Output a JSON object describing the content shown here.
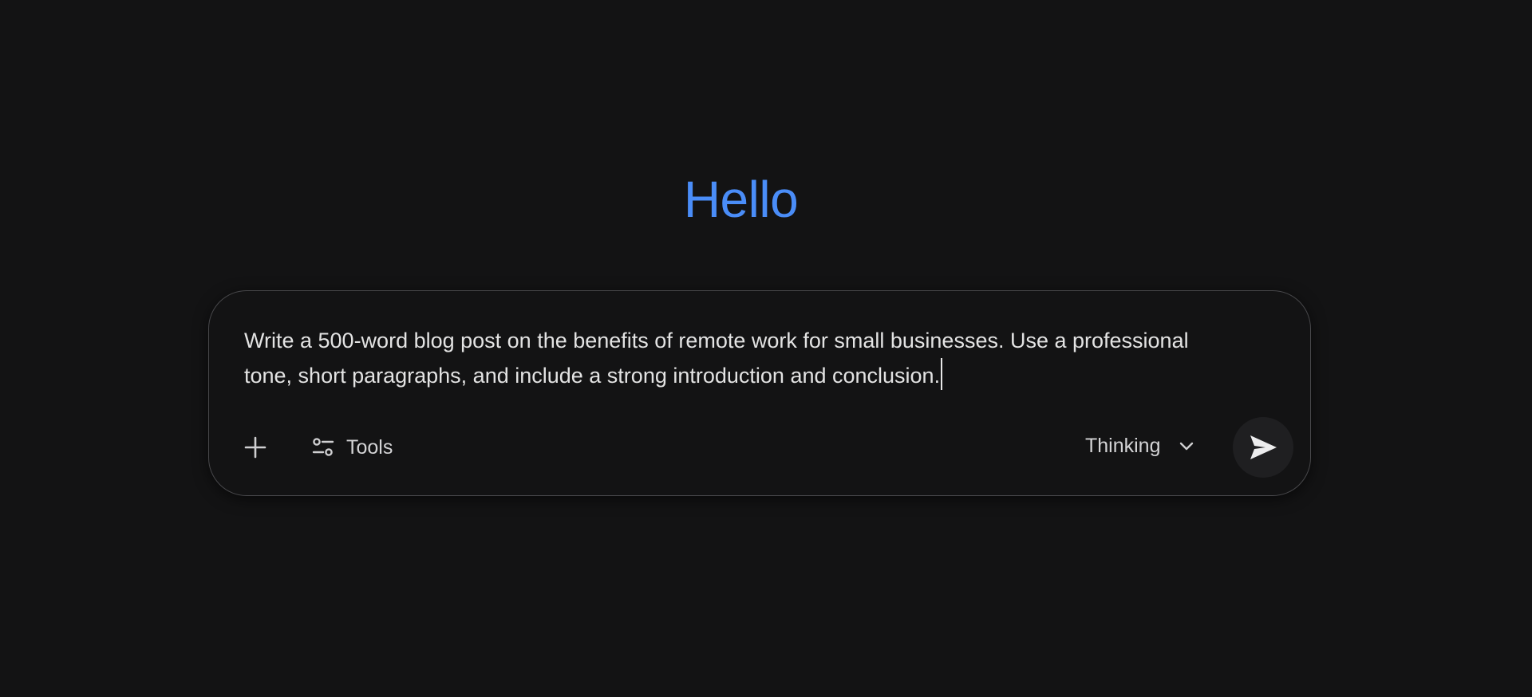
{
  "greeting": "Hello",
  "composer": {
    "prompt_text": "Write a 500-word blog post on the benefits of remote work for small businesses. Use a professional tone, short paragraphs, and include a strong introduction and conclusion.",
    "add_icon": "plus-icon",
    "tools_icon": "sliders-icon",
    "tools_label": "Tools",
    "model_label": "Thinking",
    "model_icon": "chevron-down-icon",
    "send_icon": "send-icon"
  },
  "colors": {
    "background": "#131314",
    "accent": "#4a8df8",
    "text": "#e3e3e3",
    "border": "#48484b",
    "send_button": "#1f1f21"
  }
}
